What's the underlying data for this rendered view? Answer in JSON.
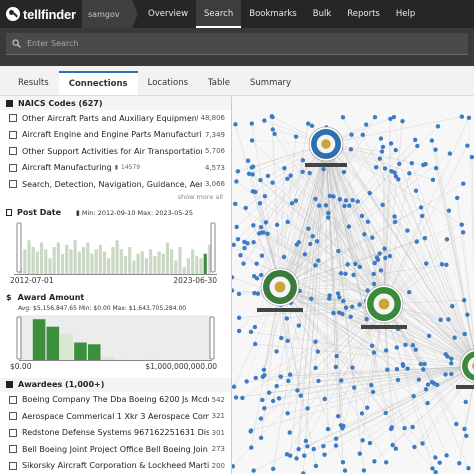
{
  "app": {
    "logo": "tellfinder",
    "user": "samgov"
  },
  "nav": {
    "items": [
      "Overview",
      "Search",
      "Bookmarks",
      "Bulk",
      "Reports",
      "Help"
    ],
    "active": "Search"
  },
  "search": {
    "placeholder": "Enter Search"
  },
  "tabs": {
    "items": [
      "Results",
      "Connections",
      "Locations",
      "Table",
      "Summary"
    ],
    "active": "Connections"
  },
  "naics": {
    "title": "NAICS Codes (627)",
    "items": [
      {
        "label": "Other Aircraft Parts and Auxiliary Equipment",
        "count": "48,806"
      },
      {
        "label": "Aircraft Engine and Engine Parts Manufacturin",
        "count": "7,349"
      },
      {
        "label": "Other Support Activities for Air Transportation",
        "count": "5,706"
      },
      {
        "label": "Aircraft Manufacturing",
        "extra": "14579",
        "count": "4,573"
      },
      {
        "label": "Search, Detection, Navigation, Guidance, Aero",
        "count": "3,066"
      }
    ],
    "show_more": "show more all"
  },
  "post_date": {
    "title": "Post Date",
    "range": "Min: 2012-09-10  Max: 2023-05-25",
    "start": "2012-07-01",
    "end": "2023-06-30",
    "bars": [
      0.15,
      0.55,
      0.75,
      0.6,
      0.5,
      0.7,
      0.55,
      0.35,
      0.6,
      0.7,
      0.45,
      0.65,
      0.55,
      0.75,
      0.5,
      0.6,
      0.7,
      0.45,
      0.55,
      0.65,
      0.5,
      0.35,
      0.6,
      0.75,
      0.55,
      0.4,
      0.6,
      0.3,
      0.45,
      0.5,
      0.35,
      0.55,
      0.4,
      0.5,
      0.45,
      0.7,
      0.55,
      0.3,
      0.6,
      0.15,
      0.35,
      0.55,
      0.4,
      0.35,
      0.45,
      0.65
    ],
    "selected_from": 1,
    "selected_to": 44
  },
  "award": {
    "title": "Award Amount",
    "stats": "Avg: $5,156,847.65  Min: $0.00  Max: $1,643,705,284.00",
    "min_label": "$0.00",
    "max_label": "$1,000,000,000.00",
    "bars": [
      0.02,
      0.95,
      0.78,
      0.62,
      0.42,
      0.38,
      0.08,
      0.03,
      0.02,
      0.03,
      0.02,
      0.02,
      0.01,
      0.02
    ],
    "selected": [
      1,
      2,
      4,
      5
    ]
  },
  "awardees": {
    "title": "Awardees (1,000+)",
    "items": [
      {
        "label": "Boeing Company The Dba Boeing 6200 Js Mcdo",
        "count": "542"
      },
      {
        "label": "Aerospace Commerical 1 Xkr 3 Aerospace Comr",
        "count": "321"
      },
      {
        "label": "Redstone Defense Systems 967162251631 Dis",
        "count": "301"
      },
      {
        "label": "Bell Boeing Joint Project Office Bell Boeing Join",
        "count": "273"
      },
      {
        "label": "Sikorsky Aircraft Corporation & Lockheed Martir",
        "count": "200"
      }
    ]
  },
  "colors": {
    "accent": "#2f6fb4",
    "node": "#3d7bc4",
    "bar_selected": "#3d8f3d",
    "bar_muted": "#c9d9c4"
  }
}
